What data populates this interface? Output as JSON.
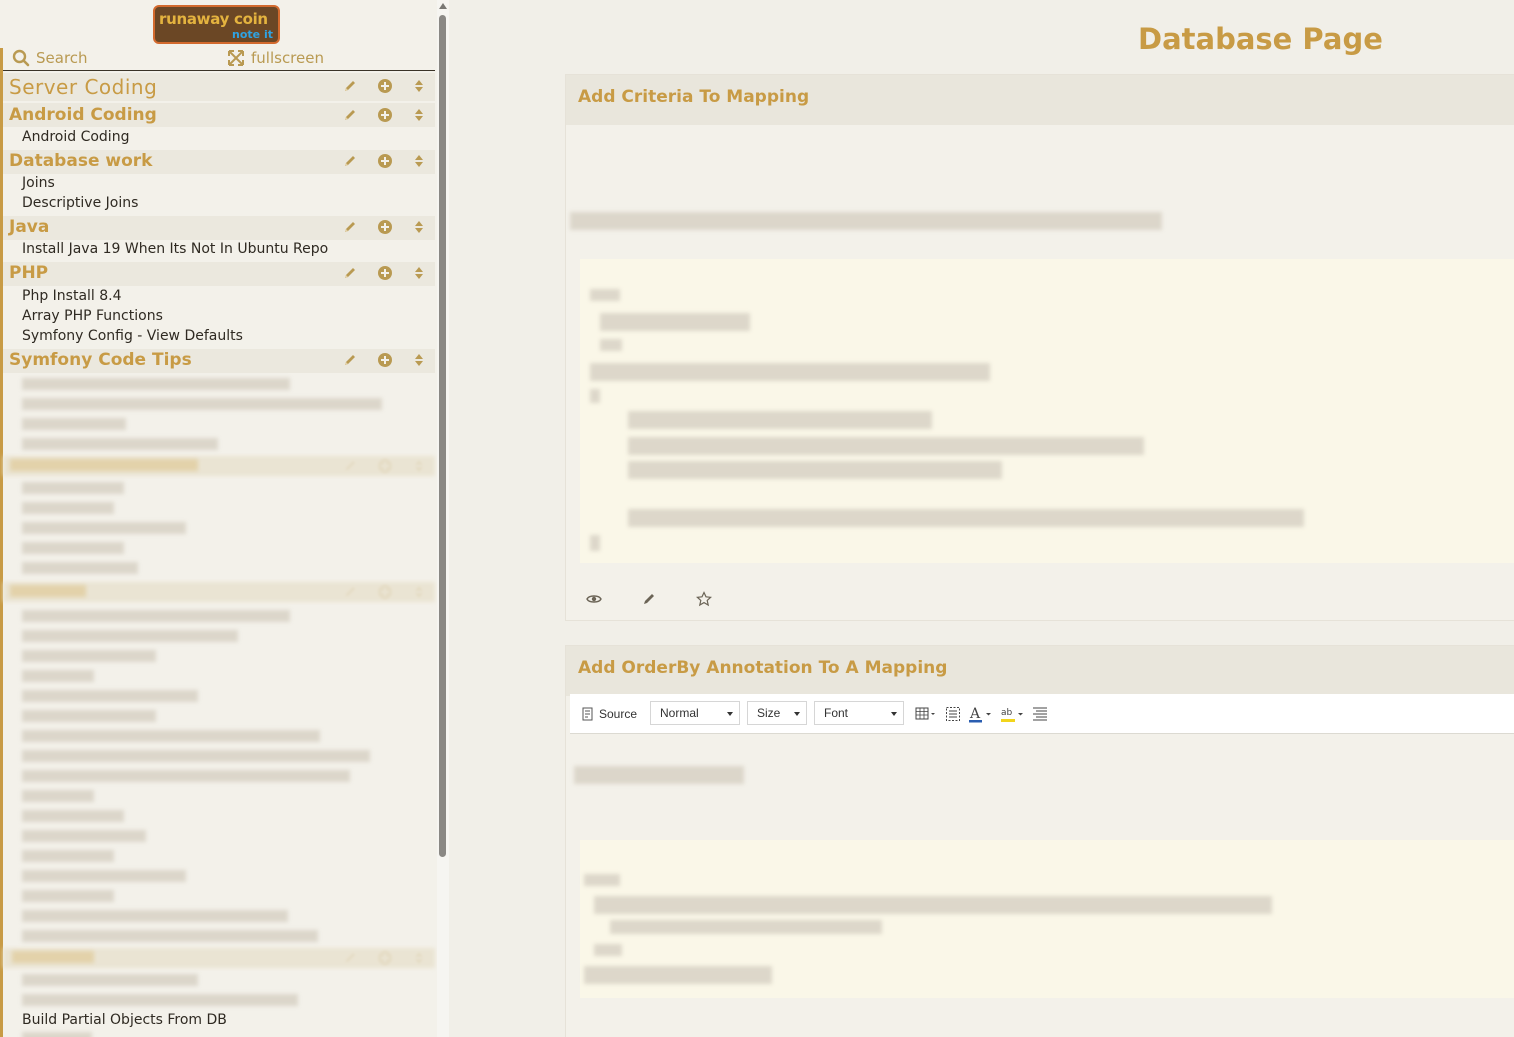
{
  "app": {
    "logo_line1": "runaway coin",
    "logo_line2": "note it"
  },
  "toolbar": {
    "search_label": "Search",
    "fullscreen_label": "fullscreen"
  },
  "sidebar": {
    "sections": [
      {
        "title": "Server Coding",
        "items": []
      },
      {
        "title": "Android Coding",
        "items": [
          "Android Coding"
        ]
      },
      {
        "title": "Database work",
        "items": [
          "Joins",
          "Descriptive Joins"
        ]
      },
      {
        "title": "Java",
        "items": [
          "Install Java 19 When Its Not In Ubuntu Repo"
        ]
      },
      {
        "title": "PHP",
        "items": [
          "Php Install 8.4",
          "Array PHP Functions",
          "Symfony Config - View Defaults"
        ]
      },
      {
        "title": "Symfony Code Tips",
        "items": []
      }
    ],
    "visible_bottom_item": "Build Partial Objects From DB"
  },
  "main": {
    "page_title": "Database Page",
    "notes": [
      {
        "title": "Add Criteria To Mapping"
      },
      {
        "title": "Add OrderBy Annotation To A Mapping"
      }
    ],
    "editor": {
      "source_label": "Source",
      "format_value": "Normal",
      "size_value": "Size",
      "font_value": "Font"
    }
  },
  "colors": {
    "accent": "#c89b45",
    "sidebar_bg": "#f3f1ea",
    "code_bg": "#faf7e8"
  }
}
